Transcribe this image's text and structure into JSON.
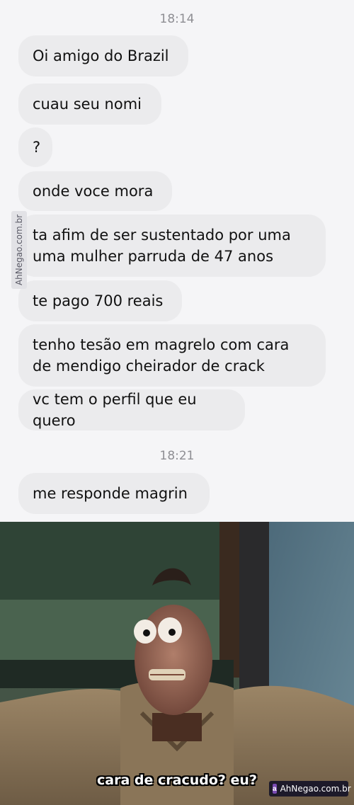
{
  "chat": {
    "messages": [
      {
        "time": "18:14"
      },
      {
        "text": "Oi amigo do Brazil"
      },
      {
        "text": "cuau seu nomi"
      },
      {
        "text": "?"
      },
      {
        "text": "onde voce mora"
      },
      {
        "text": "ta afim de ser sustentado por uma\numa mulher parruda de 47 anos"
      },
      {
        "text": "te pago 700 reais"
      },
      {
        "text": "tenho tesão em magrelo com cara\nde mendigo cheirador de crack"
      },
      {
        "text": "vc tem o perfil que eu quero"
      },
      {
        "time": "18:21"
      },
      {
        "text": "me responde magrin"
      }
    ],
    "side_watermark": "AhNegao.com.br"
  },
  "meme": {
    "caption": "cara de cracudo? eu?",
    "watermark": "AhNegao.com.br"
  }
}
